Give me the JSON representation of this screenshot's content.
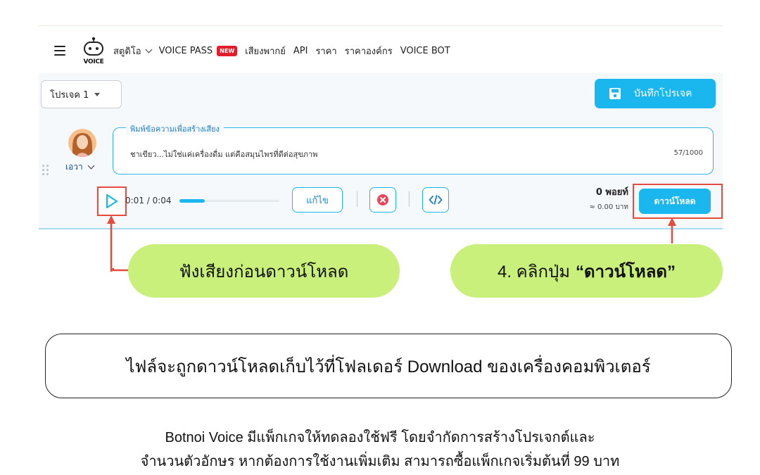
{
  "nav": {
    "items": [
      {
        "label": "สตูดิโอ",
        "has_dropdown": true
      },
      {
        "label": "VOICE PASS",
        "badge": "NEW"
      },
      {
        "label": "เสียงพากย์"
      },
      {
        "label": "API"
      },
      {
        "label": "ราคา"
      },
      {
        "label": "ราคาองค์กร"
      },
      {
        "label": "VOICE BOT"
      }
    ],
    "logo_text": "VOICE"
  },
  "app": {
    "project_select": "โปรเจค 1",
    "save_button": "บันทึกโปรเจค",
    "voice_name": "เอวา",
    "textbox": {
      "legend": "พิมพ์ข้อความเพื่อสร้างเสียง",
      "text": "ชาเขียว...ไม่ใช่แค่เครื่องดื่ม แต่คือสมุนไพรที่ดีต่อสุขภาพ",
      "char_count": "57/1000"
    },
    "player": {
      "time": "0:01 / 0:04",
      "progress": 0.25
    },
    "edit_button": "แก้ไข",
    "points": "0 พอยท์",
    "points_baht": "≈ 0.00 บาท",
    "download_button": "ดาวน์โหลด"
  },
  "callouts": {
    "left": "ฟังเสียงก่อนดาวน์โหลด",
    "right_prefix": "4. คลิกปุ่ม",
    "right_bold": "“ดาวน์โหลด”"
  },
  "note": "ไฟล์จะถูกดาวน์โหลดเก็บไว้ที่โฟลเดอร์ Download ของเครื่องคอมพิวเตอร์",
  "footer": {
    "line1": "Botnoi Voice มีแพ็กเกจให้ทดลองใช้ฟรี โดยจำกัดการสร้างโปรเจกต์และ",
    "line2": "จำนวนตัวอักษร หากต้องการใช้งานเพิ่มเติม สามารถซื้อแพ็กเกจเริ่มต้นที่ 99 บาท"
  },
  "colors": {
    "accent": "#1ab6ee",
    "highlight_border": "#e64c3c",
    "callout_bg": "#c9f07a",
    "new_badge": "#e21e2d"
  }
}
